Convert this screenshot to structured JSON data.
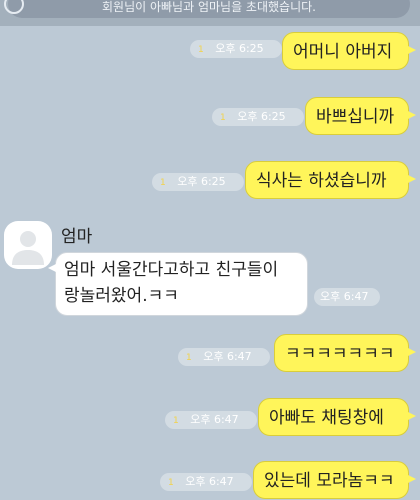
{
  "system_notice": "회원님이 아빠님과 엄마님을 초대했습니다.",
  "unread_mark": "1",
  "messages_out": [
    {
      "text": "어머니 아버지",
      "time": "오후 6:25"
    },
    {
      "text": "바쁘십니까",
      "time": "오후 6:25"
    },
    {
      "text": "식사는 하셨습니까",
      "time": "오후 6:25"
    },
    {
      "text": "ㅋㅋㅋㅋㅋㅋㅋ",
      "time": "오후 6:47"
    },
    {
      "text": "아빠도 채팅창에",
      "time": "오후 6:47"
    },
    {
      "text": "있는데 모라놈ㅋㅋ",
      "time": "오후 6:47"
    }
  ],
  "incoming": {
    "sender": "엄마",
    "lines": [
      "엄마 서울간다고하고 친구들이",
      "랑놀러왔어.ㅋㅋ"
    ],
    "time": "오후 6:47"
  },
  "colors": {
    "background": "#bcc9d5",
    "outgoing_bubble": "#fff55a",
    "incoming_bubble": "#ffffff"
  }
}
